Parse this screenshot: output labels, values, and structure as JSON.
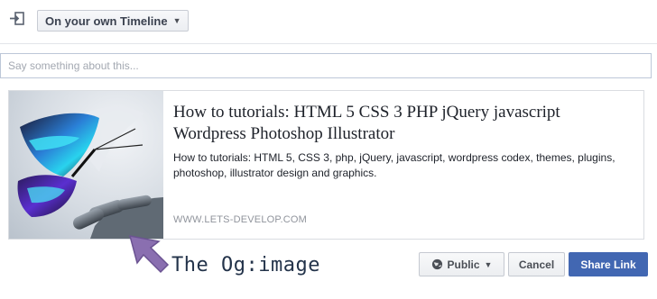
{
  "header": {
    "share_icon": "share-arrow-icon",
    "destination_label": "On your own Timeline"
  },
  "composer": {
    "placeholder": "Say something about this..."
  },
  "preview": {
    "title": "How to tutorials: HTML 5 CSS 3 PHP jQuery javascript Wordpress Photoshop Illustrator",
    "description": "How to tutorials: HTML 5, CSS 3, php, jQuery, javascript, wordpress codex, themes, plugins, photoshop, illustrator design and graphics.",
    "domain": "WWW.LETS-DEVELOP.COM"
  },
  "annotation": {
    "label": "The Og:image",
    "color": "#8a6fb0"
  },
  "footer": {
    "audience_label": "Public",
    "cancel_label": "Cancel",
    "share_label": "Share Link",
    "share_color": "#4267b2"
  }
}
